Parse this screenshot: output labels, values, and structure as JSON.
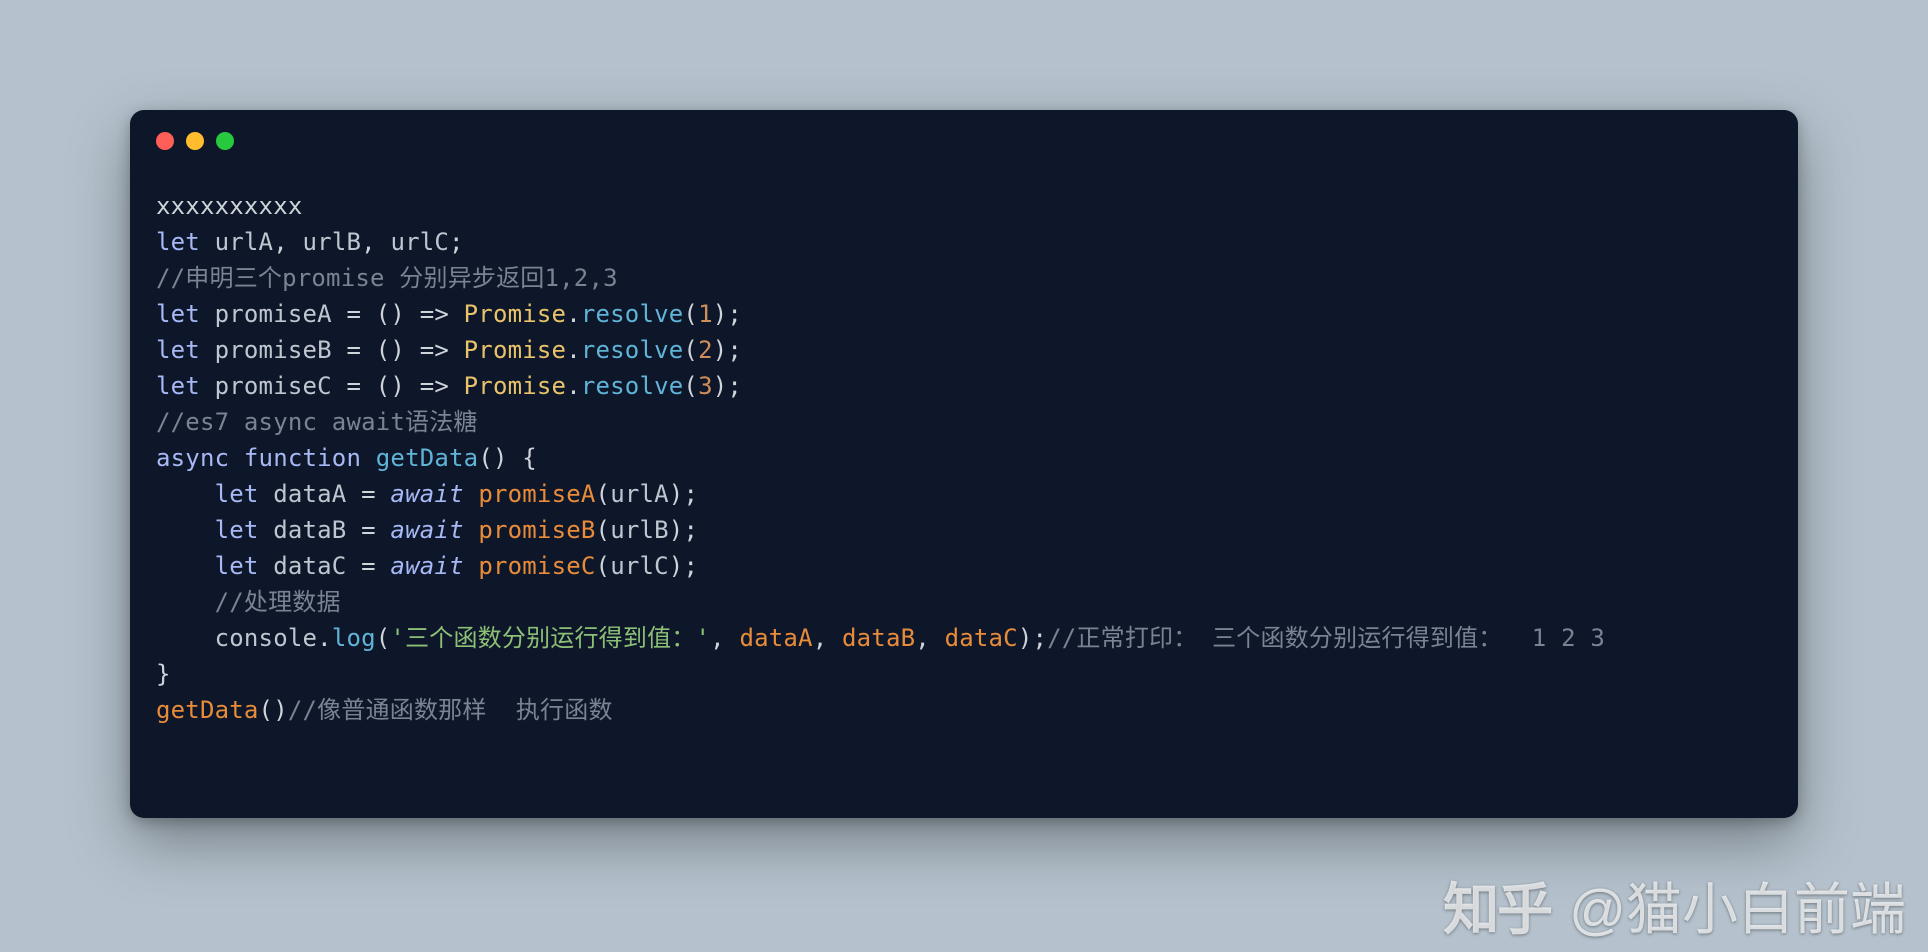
{
  "colors": {
    "page_bg": "#b5c2cd",
    "card_bg": "#0e1629",
    "traffic_red": "#ff5f56",
    "traffic_yellow": "#ffbd2e",
    "traffic_green": "#27c93f"
  },
  "traffic_lights": [
    "close",
    "minimize",
    "zoom"
  ],
  "code_lines": [
    [
      {
        "t": "xxxxxxxxxx",
        "c": "plain"
      }
    ],
    [
      {
        "t": "let",
        "c": "keyword"
      },
      {
        "t": " urlA",
        "c": "ident"
      },
      {
        "t": ", ",
        "c": "punct"
      },
      {
        "t": "urlB",
        "c": "ident"
      },
      {
        "t": ", ",
        "c": "punct"
      },
      {
        "t": "urlC",
        "c": "ident"
      },
      {
        "t": ";",
        "c": "punct"
      }
    ],
    [
      {
        "t": "//申明三个promise 分别异步返回1,2,3",
        "c": "comment"
      }
    ],
    [
      {
        "t": "let",
        "c": "keyword"
      },
      {
        "t": " promiseA ",
        "c": "ident"
      },
      {
        "t": "= () => ",
        "c": "punct"
      },
      {
        "t": "Promise",
        "c": "class"
      },
      {
        "t": ".",
        "c": "punct"
      },
      {
        "t": "resolve",
        "c": "func"
      },
      {
        "t": "(",
        "c": "punct"
      },
      {
        "t": "1",
        "c": "number"
      },
      {
        "t": ");",
        "c": "punct"
      }
    ],
    [
      {
        "t": "let",
        "c": "keyword"
      },
      {
        "t": " promiseB ",
        "c": "ident"
      },
      {
        "t": "= () => ",
        "c": "punct"
      },
      {
        "t": "Promise",
        "c": "class"
      },
      {
        "t": ".",
        "c": "punct"
      },
      {
        "t": "resolve",
        "c": "func"
      },
      {
        "t": "(",
        "c": "punct"
      },
      {
        "t": "2",
        "c": "number"
      },
      {
        "t": ");",
        "c": "punct"
      }
    ],
    [
      {
        "t": "let",
        "c": "keyword"
      },
      {
        "t": " promiseC ",
        "c": "ident"
      },
      {
        "t": "= () => ",
        "c": "punct"
      },
      {
        "t": "Promise",
        "c": "class"
      },
      {
        "t": ".",
        "c": "punct"
      },
      {
        "t": "resolve",
        "c": "func"
      },
      {
        "t": "(",
        "c": "punct"
      },
      {
        "t": "3",
        "c": "number"
      },
      {
        "t": ");",
        "c": "punct"
      }
    ],
    [
      {
        "t": "//es7 async await语法糖",
        "c": "comment"
      }
    ],
    [
      {
        "t": "async",
        "c": "keyword"
      },
      {
        "t": " ",
        "c": "plain"
      },
      {
        "t": "function",
        "c": "keyword"
      },
      {
        "t": " ",
        "c": "plain"
      },
      {
        "t": "getData",
        "c": "func"
      },
      {
        "t": "() {",
        "c": "punct"
      }
    ],
    [
      {
        "t": "    ",
        "c": "plain"
      },
      {
        "t": "let",
        "c": "keyword"
      },
      {
        "t": " dataA ",
        "c": "ident"
      },
      {
        "t": "= ",
        "c": "punct"
      },
      {
        "t": "await",
        "c": "keyword2"
      },
      {
        "t": " ",
        "c": "plain"
      },
      {
        "t": "promiseA",
        "c": "call"
      },
      {
        "t": "(",
        "c": "punct"
      },
      {
        "t": "urlA",
        "c": "ident"
      },
      {
        "t": ");",
        "c": "punct"
      }
    ],
    [
      {
        "t": "    ",
        "c": "plain"
      },
      {
        "t": "let",
        "c": "keyword"
      },
      {
        "t": " dataB ",
        "c": "ident"
      },
      {
        "t": "= ",
        "c": "punct"
      },
      {
        "t": "await",
        "c": "keyword2"
      },
      {
        "t": " ",
        "c": "plain"
      },
      {
        "t": "promiseB",
        "c": "call"
      },
      {
        "t": "(",
        "c": "punct"
      },
      {
        "t": "urlB",
        "c": "ident"
      },
      {
        "t": ");",
        "c": "punct"
      }
    ],
    [
      {
        "t": "    ",
        "c": "plain"
      },
      {
        "t": "let",
        "c": "keyword"
      },
      {
        "t": " dataC ",
        "c": "ident"
      },
      {
        "t": "= ",
        "c": "punct"
      },
      {
        "t": "await",
        "c": "keyword2"
      },
      {
        "t": " ",
        "c": "plain"
      },
      {
        "t": "promiseC",
        "c": "call"
      },
      {
        "t": "(",
        "c": "punct"
      },
      {
        "t": "urlC",
        "c": "ident"
      },
      {
        "t": ");",
        "c": "punct"
      }
    ],
    [
      {
        "t": "    ",
        "c": "plain"
      },
      {
        "t": "//处理数据",
        "c": "comment"
      }
    ],
    [
      {
        "t": "    ",
        "c": "plain"
      },
      {
        "t": "console",
        "c": "ident"
      },
      {
        "t": ".",
        "c": "punct"
      },
      {
        "t": "log",
        "c": "func"
      },
      {
        "t": "(",
        "c": "punct"
      },
      {
        "t": "'三个函数分别运行得到值：'",
        "c": "string"
      },
      {
        "t": ", ",
        "c": "punct"
      },
      {
        "t": "dataA",
        "c": "call"
      },
      {
        "t": ", ",
        "c": "punct"
      },
      {
        "t": "dataB",
        "c": "call"
      },
      {
        "t": ", ",
        "c": "punct"
      },
      {
        "t": "dataC",
        "c": "call"
      },
      {
        "t": ");",
        "c": "punct"
      },
      {
        "t": "//正常打印： 三个函数分别运行得到值：  1 2 3",
        "c": "comment"
      }
    ],
    [
      {
        "t": "}",
        "c": "punct"
      }
    ],
    [
      {
        "t": "getData",
        "c": "call"
      },
      {
        "t": "()",
        "c": "punct"
      },
      {
        "t": "//像普通函数那样  执行函数",
        "c": "comment"
      }
    ]
  ],
  "watermark": {
    "logo_text": "知乎",
    "handle": "@猫小白前端"
  }
}
